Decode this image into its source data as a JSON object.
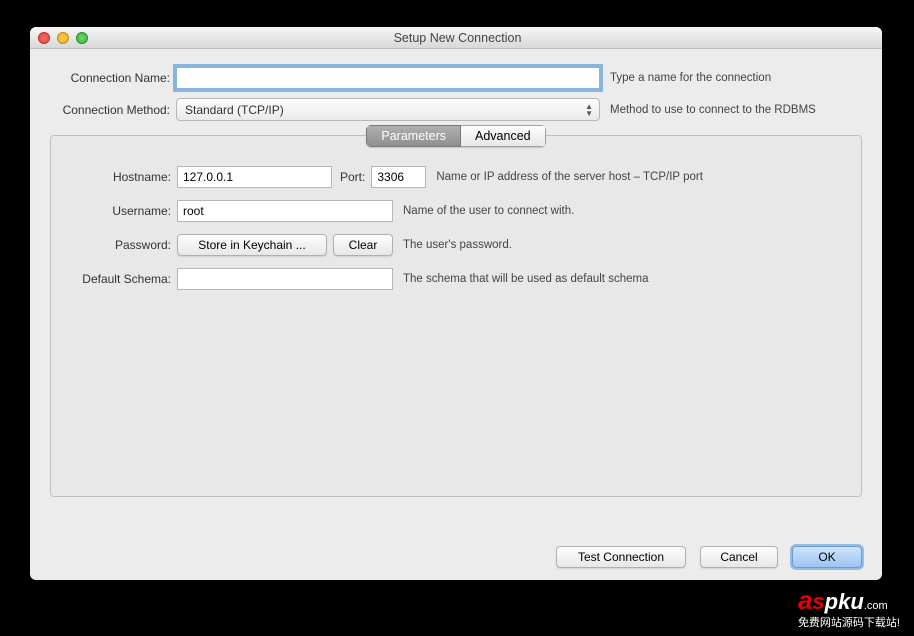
{
  "window": {
    "title": "Setup New Connection"
  },
  "top": {
    "name_label": "Connection Name:",
    "name_value": "",
    "name_help": "Type a name for the connection",
    "method_label": "Connection Method:",
    "method_value": "Standard (TCP/IP)",
    "method_help": "Method to use to connect to the RDBMS"
  },
  "tabs": {
    "parameters": "Parameters",
    "advanced": "Advanced"
  },
  "params": {
    "hostname_label": "Hostname:",
    "hostname_value": "127.0.0.1",
    "port_label": "Port:",
    "port_value": "3306",
    "host_help": "Name or IP address of the server host – TCP/IP port",
    "username_label": "Username:",
    "username_value": "root",
    "username_help": "Name of the user to connect with.",
    "password_label": "Password:",
    "store_label": "Store in Keychain ...",
    "clear_label": "Clear",
    "password_help": "The user's password.",
    "schema_label": "Default Schema:",
    "schema_value": "",
    "schema_help": "The schema that will be used as default schema"
  },
  "footer": {
    "test": "Test Connection",
    "cancel": "Cancel",
    "ok": "OK"
  },
  "watermark": {
    "domain": ".com",
    "sub": "免费网站源码下载站!"
  }
}
